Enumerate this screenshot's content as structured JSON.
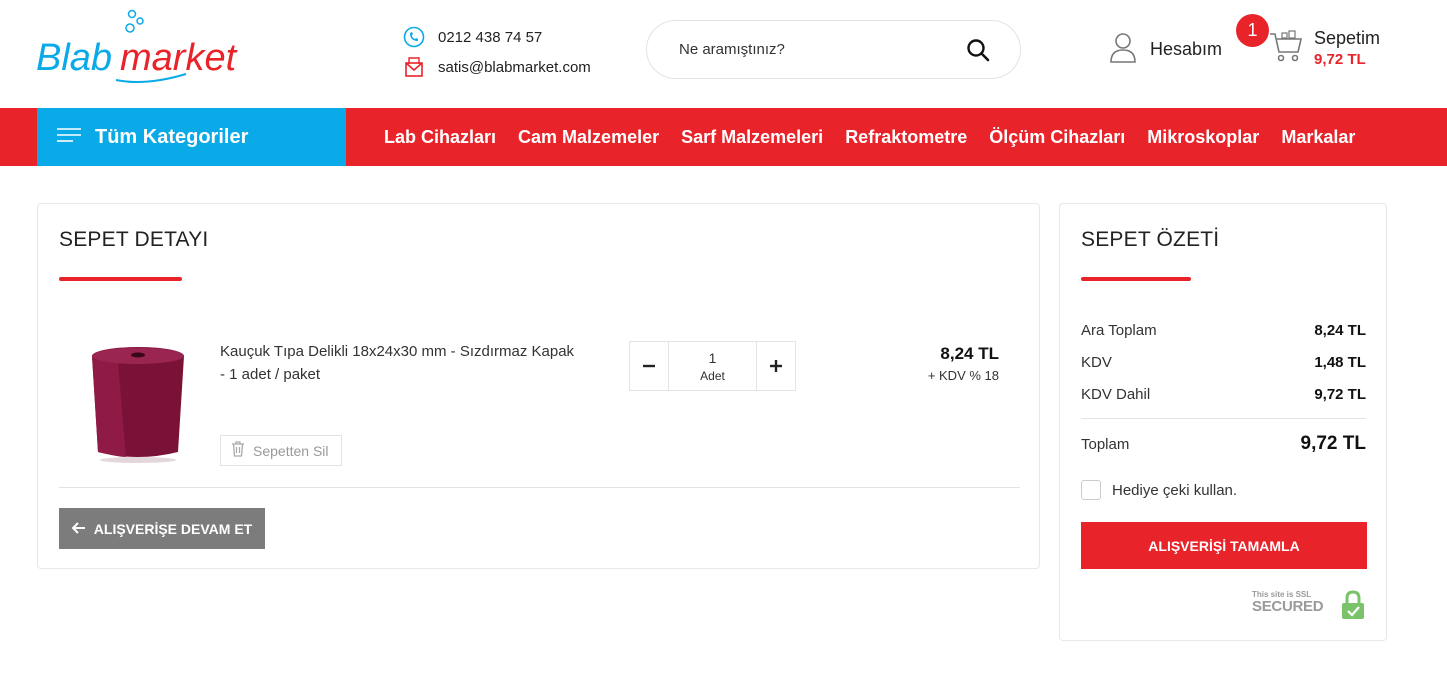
{
  "header": {
    "logo_text_blue": "Blab",
    "logo_text_red": "market",
    "phone": "0212 438 74 57",
    "email": "satis@blabmarket.com",
    "search_placeholder": "Ne aramıştınız?",
    "account_label": "Hesabım",
    "cart_count": "1",
    "cart_label": "Sepetim",
    "cart_total": "9,72 TL"
  },
  "nav": {
    "categories_label": "Tüm Kategoriler",
    "items": [
      "Lab Cihazları",
      "Cam Malzemeler",
      "Sarf Malzemeleri",
      "Refraktometre",
      "Ölçüm Cihazları",
      "Mikroskoplar",
      "Markalar"
    ]
  },
  "cart_detail": {
    "title": "SEPET DETAYI",
    "item": {
      "name": "Kauçuk Tıpa Delikli 18x24x30 mm - Sızdırmaz Kapak - 1 adet / paket",
      "quantity": "1",
      "unit": "Adet",
      "price": "8,24 TL",
      "tax_note": "+ KDV % 18",
      "remove_label": "Sepetten Sil"
    },
    "continue_label": "ALIŞVERİŞE DEVAM ET"
  },
  "summary": {
    "title": "SEPET ÖZETİ",
    "subtotal_label": "Ara Toplam",
    "subtotal_value": "8,24 TL",
    "tax_label": "KDV",
    "tax_value": "1,48 TL",
    "incl_label": "KDV Dahil",
    "incl_value": "9,72 TL",
    "total_label": "Toplam",
    "total_value": "9,72 TL",
    "gift_label": "Hediye çeki kullan.",
    "checkout_label": "ALIŞVERİŞİ TAMAMLA",
    "ssl_line1": "This site is SSL",
    "ssl_line2": "SECURED"
  },
  "colors": {
    "brand_red": "#e8232a",
    "brand_blue": "#0aa9e8",
    "button_gray": "#7c7c7c"
  }
}
